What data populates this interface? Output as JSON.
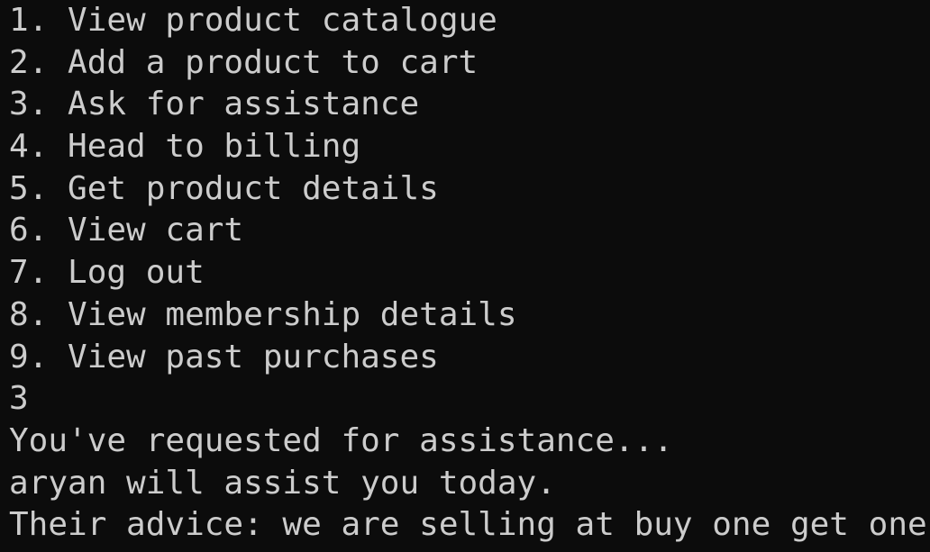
{
  "terminal": {
    "menu": [
      "1. View product catalogue",
      "2. Add a product to cart",
      "3. Ask for assistance",
      "4. Head to billing",
      "5. Get product details",
      "6. View cart",
      "7. Log out",
      "8. View membership details",
      "9. View past purchases"
    ],
    "input": "3",
    "output": [
      "You've requested for assistance...",
      "aryan will assist you today.",
      "Their advice: we are selling at buy one get one!"
    ]
  },
  "colors": {
    "background": "#0c0c0c",
    "text": "#cccccc"
  }
}
